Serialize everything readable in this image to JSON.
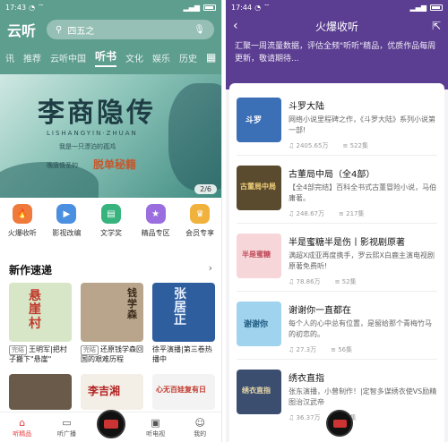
{
  "left": {
    "status": {
      "time": "17:43"
    },
    "app_logo": "云听",
    "search_placeholder": "四五之",
    "categories": [
      "讯",
      "推荐",
      "云听中国",
      "听书",
      "文化",
      "娱乐",
      "历史"
    ],
    "banner": {
      "title": "李商隐传",
      "pinyin": "LISHANGYIN·ZHUAN",
      "small": "我是一只漂泊的孤鸿",
      "slogan_pre": "晚唐情圣的",
      "slogan": "脱单秘籍",
      "page": "2/6"
    },
    "quick": [
      {
        "label": "火爆收听",
        "icon": "fire-icon",
        "color": "#f07a3c"
      },
      {
        "label": "影视改编",
        "icon": "film-icon",
        "color": "#4a8fe0"
      },
      {
        "label": "文学奖",
        "icon": "book-icon",
        "color": "#37b37e"
      },
      {
        "label": "精品专区",
        "icon": "star-icon",
        "color": "#9b6ee0"
      },
      {
        "label": "会员专享",
        "icon": "crown-icon",
        "color": "#f0b23c"
      }
    ],
    "section_title": "新作速递",
    "section_more": "›",
    "books": [
      {
        "cover_text": "悬崖村",
        "tag": "完结",
        "desc": "王明军|把村子搬下\"悬崖\"",
        "bg": "#d8e6c8",
        "fg": "#c0392b"
      },
      {
        "cover_text": "钱学森",
        "tag": "完结",
        "desc": "还原钱学森回国的艰难历程",
        "bg": "#b9a58c",
        "fg": "#3a2a1a"
      },
      {
        "cover_text": "张居正",
        "tag": "",
        "desc": "徐平演播|第三卷热播中",
        "bg": "#2f5e9e",
        "fg": "#e8f0ff"
      }
    ],
    "row2": [
      {
        "cover_text": "",
        "bg": "#6a5a4a",
        "fg": "#fff"
      },
      {
        "cover_text": "李吉湘",
        "bg": "#f4efe6",
        "fg": "#b22222"
      },
      {
        "cover_text": "心无百娃复有日",
        "bg": "#f3f3f3",
        "fg": "#c0392b"
      }
    ],
    "tabs": [
      {
        "label": "听精品",
        "icon": "home-icon",
        "active": true
      },
      {
        "label": "听广播",
        "icon": "radio-icon",
        "active": false
      },
      {
        "label": "",
        "icon": "disc-icon",
        "active": false
      },
      {
        "label": "听电视",
        "icon": "tv-icon",
        "active": false
      },
      {
        "label": "我的",
        "icon": "user-icon",
        "active": false
      }
    ]
  },
  "right": {
    "status": {
      "time": "17:44"
    },
    "title": "火爆收听",
    "intro": "汇聚一周流量数据，评估全频\"听听\"精品，优质作品每周更新，敬请期待...",
    "items": [
      {
        "name": "斗罗大陆",
        "desc": "网络小说里程碑之作，《斗罗大陆》系列小说第一部!",
        "plays": "2405.65万",
        "count": "522集",
        "bg": "#3b6fb6",
        "fg": "#fff",
        "cover": "斗罗"
      },
      {
        "name": "古董局中局（全4部）",
        "desc": "【全4部完结】百科全书式古董冒险小说，马伯庸著。",
        "plays": "248.67万",
        "count": "217集",
        "bg": "#5a4a2e",
        "fg": "#f3d27a",
        "cover": "古董局中局"
      },
      {
        "name": "半是蜜糖半是伤丨影视剧原著",
        "desc": "满超X成亚再度携手，罗云熙X白鹿主演电视剧原著免费听!",
        "plays": "78.86万",
        "count": "52集",
        "bg": "#f6d6d8",
        "fg": "#c04a5a",
        "cover": "半是蜜糖"
      },
      {
        "name": "谢谢你一直都在",
        "desc": "每个人的心中总有位置，是留给那个青梅竹马的初恋的。",
        "plays": "27.3万",
        "count": "56集",
        "bg": "#9fd3ee",
        "fg": "#1e5a80",
        "cover": "谢谢你"
      },
      {
        "name": "绣衣直指",
        "desc": "张东演播，小曾制作！|定智多谋绣衣使VS励精图治汉武帝",
        "plays": "36.37万",
        "count": "56集",
        "bg": "#3b4e70",
        "fg": "#e9d9a8",
        "cover": "绣衣直指"
      }
    ]
  }
}
